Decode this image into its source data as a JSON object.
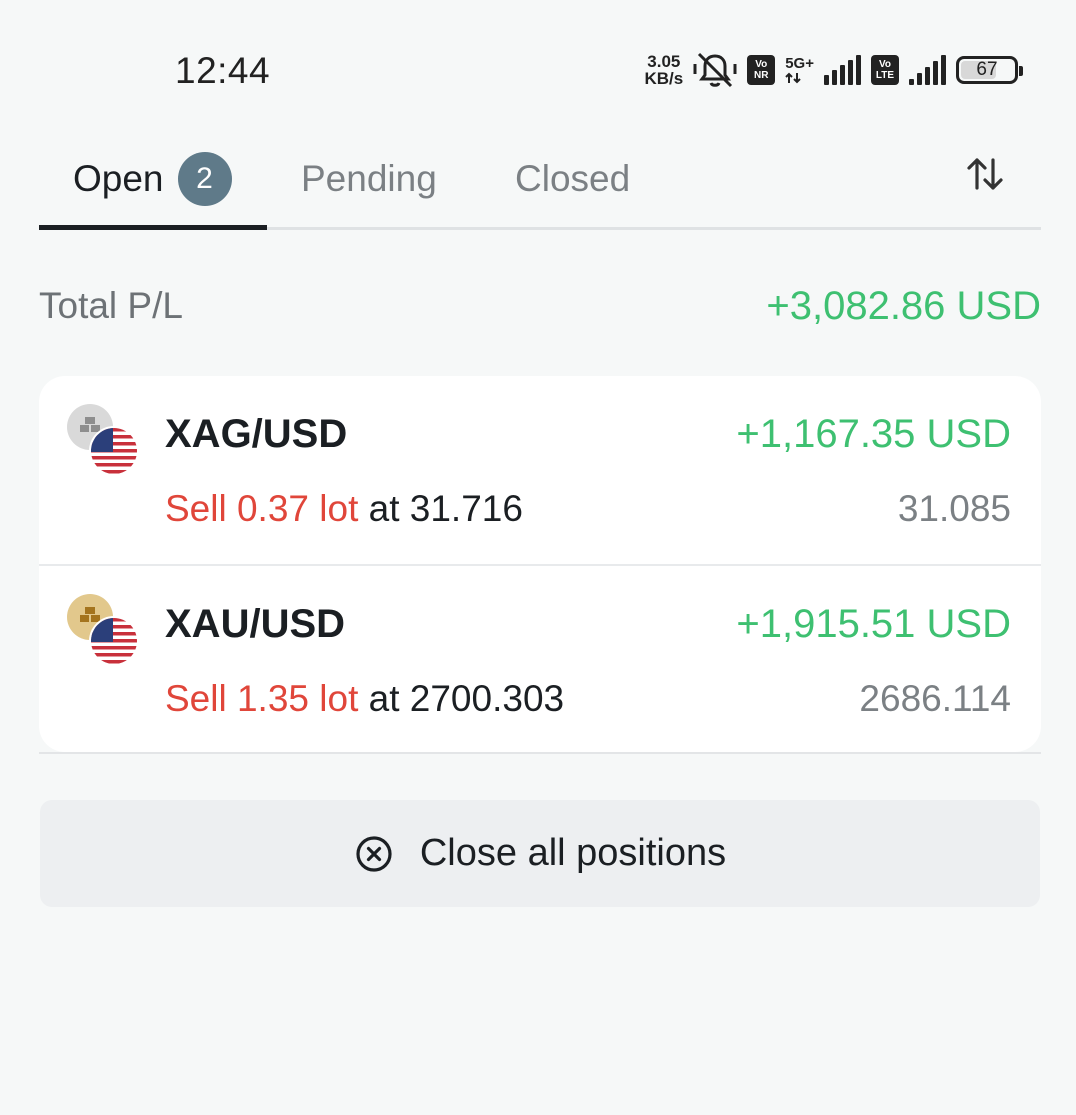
{
  "status_bar": {
    "time": "12:44",
    "net_speed_value": "3.05",
    "net_speed_unit": "KB/s",
    "vonr_top": "Vo",
    "vonr_bottom": "NR",
    "network_type": "5G+",
    "volte_top": "Vo",
    "volte_bottom": "LTE",
    "battery_level": "67",
    "icons": [
      "bell-off-icon",
      "signal-icon",
      "battery-icon"
    ]
  },
  "tabs": [
    {
      "label": "Open",
      "count": "2",
      "active": true
    },
    {
      "label": "Pending",
      "active": false
    },
    {
      "label": "Closed",
      "active": false
    }
  ],
  "sort_icon": "sort-arrows-icon",
  "total": {
    "label": "Total P/L",
    "value": "+3,082.86 USD"
  },
  "positions": [
    {
      "symbol": "XAG/USD",
      "pl": "+1,167.35 USD",
      "side_text": "Sell 0.37 lot",
      "at_text": " at 31.716",
      "current_price": "31.085",
      "base_icon": "silver-ingot-icon",
      "quote_icon": "us-flag-icon"
    },
    {
      "symbol": "XAU/USD",
      "pl": "+1,915.51 USD",
      "side_text": "Sell 1.35 lot",
      "at_text": " at 2700.303",
      "current_price": "2686.114",
      "base_icon": "gold-ingot-icon",
      "quote_icon": "us-flag-icon"
    }
  ],
  "close_all": {
    "label": "Close all positions",
    "icon": "close-circle-icon"
  },
  "colors": {
    "profit": "#3ec071",
    "sell": "#e0463a",
    "badge": "#5f7a89",
    "gold": "#e2c88c",
    "silver": "#d9d9d9"
  }
}
